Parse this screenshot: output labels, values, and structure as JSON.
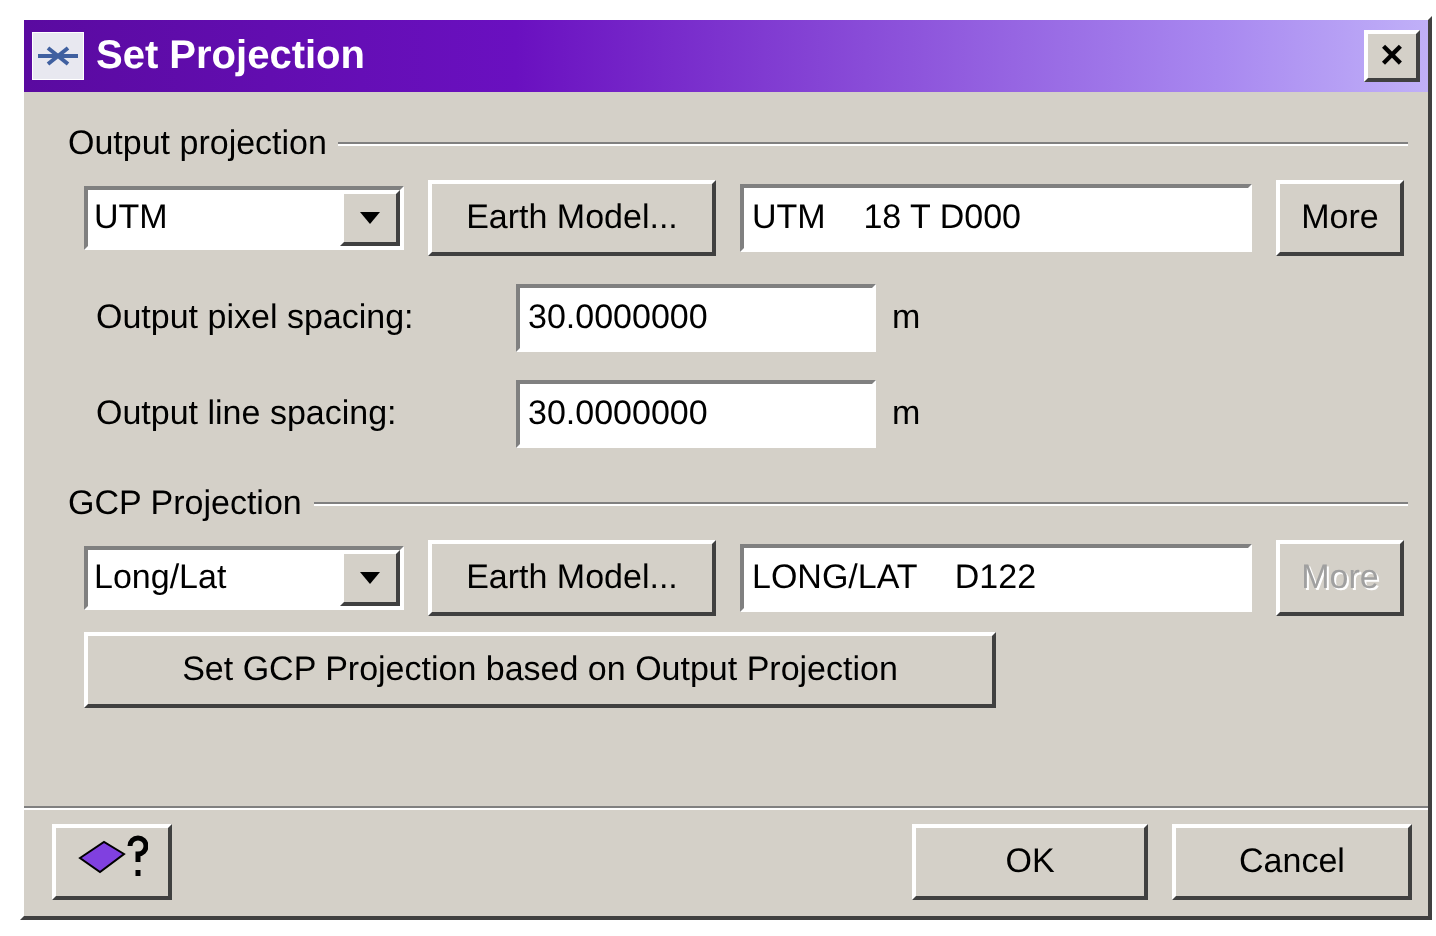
{
  "window": {
    "title": "Set Projection",
    "close": "×"
  },
  "output_projection": {
    "heading": "Output projection",
    "projection": "UTM",
    "earth_model": "Earth Model...",
    "description": "UTM    18 T D000",
    "more": {
      "label": "More",
      "disabled": false
    }
  },
  "spacing": [
    {
      "label": "Output pixel spacing:",
      "value": "30.0000000",
      "unit": "m"
    },
    {
      "label": "Output line spacing:",
      "value": "30.0000000",
      "unit": "m"
    }
  ],
  "gcp_projection": {
    "heading": "GCP Projection",
    "projection": "Long/Lat",
    "earth_model": "Earth Model...",
    "description": "LONG/LAT    D122",
    "more": {
      "label": "More",
      "disabled": true
    },
    "set_button": "Set GCP Projection based on Output Projection"
  },
  "buttons": [
    "OK",
    "Cancel"
  ]
}
